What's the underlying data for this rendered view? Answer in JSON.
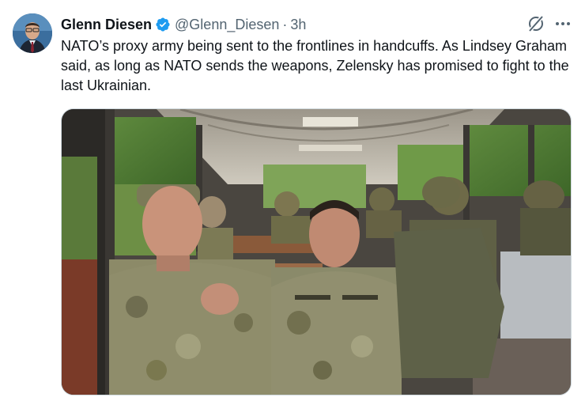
{
  "tweet": {
    "author": {
      "display_name": "Glenn Diesen",
      "handle": "@Glenn_Diesen",
      "verified": true
    },
    "separator": "·",
    "time": "3h",
    "text": "NATO’s proxy army being sent to the frontlines in handcuffs. As Lindsey Graham said, as long as NATO sends the weapons, Zelensky has promised to fight to the last Ukrainian.",
    "icons": {
      "verified": "verified-badge-icon",
      "grok": "grok-icon",
      "more": "more-options-icon"
    },
    "colors": {
      "verified": "#1d9bf0",
      "secondary_text": "#536471",
      "primary_text": "#0f1419"
    }
  }
}
